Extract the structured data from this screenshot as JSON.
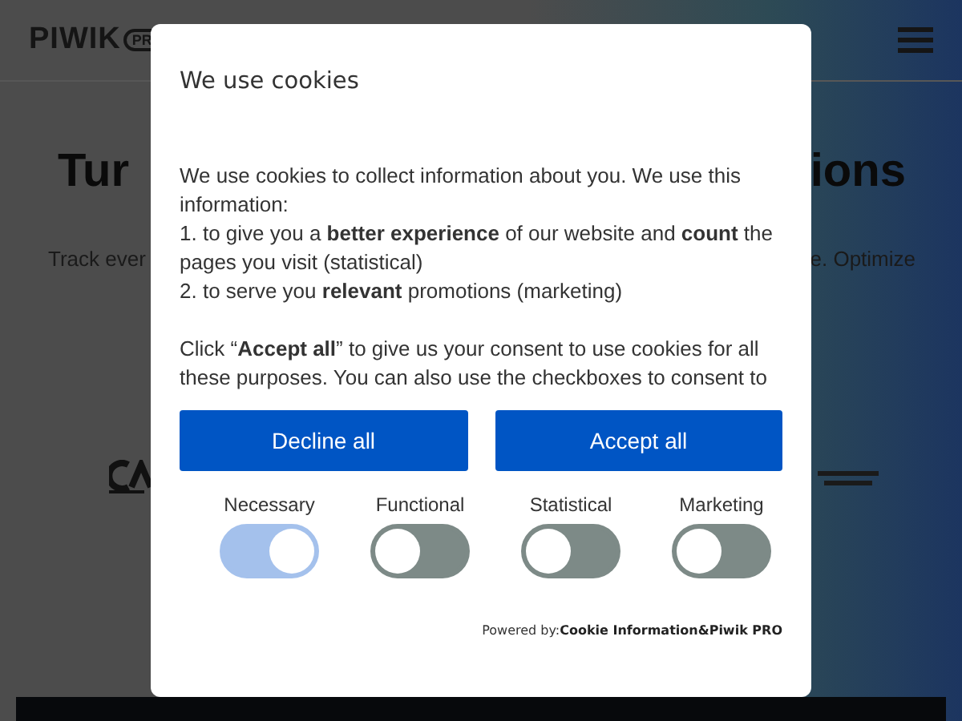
{
  "page": {
    "logo": "PIWIK",
    "logo_badge": "PR",
    "headline_left": "Tur",
    "headline_right": "ions",
    "subline_left": "Track ever",
    "subline_right": "e. Optimize"
  },
  "dialog": {
    "title": "We use cookies",
    "paragraphs": [
      "We use cookies to collect information about you. We use this information:\n1. to give you a **better experience** of our website and **count** the pages you visit (statistical)\n2. to serve you **relevant** promotions (marketing)",
      "Click “**Accept all**” to give us your consent to use cookies for all these purposes. You can also use the checkboxes to consent to"
    ],
    "buttons": [
      "Decline all",
      "Accept all"
    ],
    "toggles": [
      {
        "label": "Necessary",
        "checked": true,
        "disabled": true
      },
      {
        "label": "Functional",
        "checked": false,
        "disabled": false
      },
      {
        "label": "Statistical",
        "checked": false,
        "disabled": false
      },
      {
        "label": "Marketing",
        "checked": false,
        "disabled": false
      }
    ],
    "powered_by": "Powered by:",
    "powered_links": [
      "Cookie Information",
      "&",
      "Piwik PRO"
    ]
  }
}
